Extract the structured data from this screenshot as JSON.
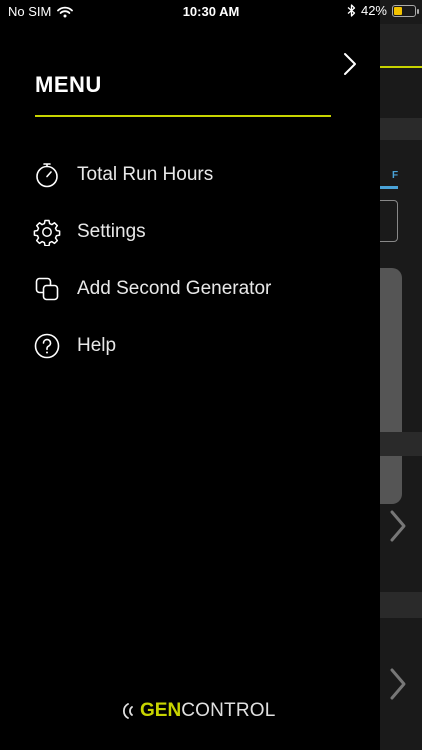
{
  "status_bar": {
    "carrier": "No SIM",
    "time": "10:30 AM",
    "battery_percent": "42%",
    "battery_level": 0.42,
    "battery_color": "#f2c200"
  },
  "menu": {
    "title": "MENU",
    "accent_color": "#c8d400",
    "close_icon": "chevron-right-icon",
    "items": [
      {
        "label": "Total Run Hours",
        "icon": "stopwatch-icon"
      },
      {
        "label": "Settings",
        "icon": "gear-icon"
      },
      {
        "label": "Add Second Generator",
        "icon": "two-squares-icon"
      },
      {
        "label": "Help",
        "icon": "question-circle-icon"
      }
    ]
  },
  "logo": {
    "gen": "GEN",
    "control": "CONTROL"
  },
  "background": {
    "tab_label": "F"
  }
}
